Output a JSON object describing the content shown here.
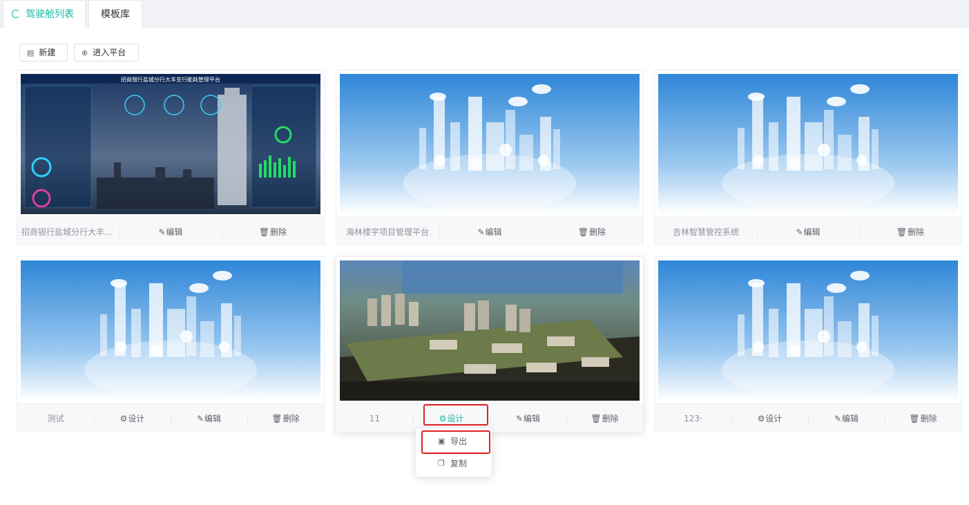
{
  "tabs": [
    {
      "label": "驾驶舱列表",
      "active": true
    },
    {
      "label": "模板库",
      "active": false
    }
  ],
  "toolbar": {
    "new_label": "新建",
    "enter_label": "进入平台"
  },
  "actions": {
    "edit": "编辑",
    "delete": "删除",
    "design": "设计"
  },
  "cards": [
    {
      "title": "招商银行盐城分行大丰支...",
      "thumb_text": "招商银行盐城分行大丰支行能耗管理平台"
    },
    {
      "title": "海林楼宇项目管理平台"
    },
    {
      "title": "吉林智慧管控系统"
    },
    {
      "title": "测试"
    },
    {
      "title": "11"
    },
    {
      "title": "123·"
    }
  ],
  "dropdown": {
    "items": [
      "导出",
      "复制"
    ]
  },
  "colors": {
    "accent": "#14b8a6",
    "annotation": "#e02020",
    "sky_top": "#2f86d8",
    "sky_bottom": "#ffffff"
  }
}
